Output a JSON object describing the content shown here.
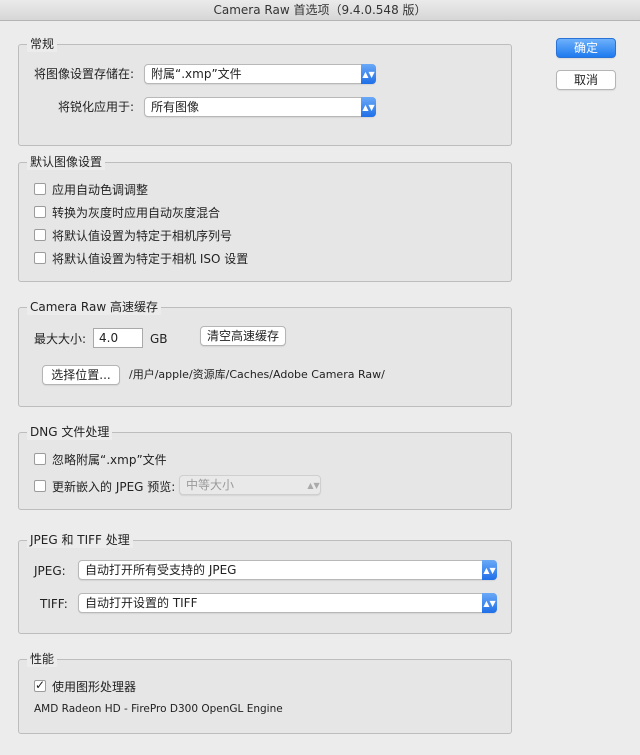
{
  "window": {
    "title": "Camera Raw 首选项（9.4.0.548 版）"
  },
  "buttons": {
    "ok": "确定",
    "cancel": "取消"
  },
  "general": {
    "legend": "常规",
    "save_settings_label": "将图像设置存储在:",
    "save_settings_value": "附属“.xmp”文件",
    "sharpen_label": "将锐化应用于:",
    "sharpen_value": "所有图像"
  },
  "defaults": {
    "legend": "默认图像设置",
    "options": [
      {
        "label": "应用自动色调调整",
        "checked": false
      },
      {
        "label": "转换为灰度时应用自动灰度混合",
        "checked": false
      },
      {
        "label": "将默认值设置为特定于相机序列号",
        "checked": false
      },
      {
        "label": "将默认值设置为特定于相机 ISO 设置",
        "checked": false
      }
    ]
  },
  "cache": {
    "legend": "Camera Raw 高速缓存",
    "max_size_label": "最大大小:",
    "max_size_value": "4.0",
    "unit": "GB",
    "purge_button": "清空高速缓存",
    "select_location_button": "选择位置...",
    "path": "/用户/apple/资源库/Caches/Adobe Camera Raw/"
  },
  "dng": {
    "legend": "DNG 文件处理",
    "ignore_xmp": {
      "label": "忽略附属“.xmp”文件",
      "checked": false
    },
    "update_jpeg": {
      "label": "更新嵌入的 JPEG 预览:",
      "checked": false
    },
    "preview_size": "中等大小"
  },
  "jpeg_tiff": {
    "legend": "JPEG 和 TIFF 处理",
    "jpeg_label": "JPEG:",
    "jpeg_value": "自动打开所有受支持的 JPEG",
    "tiff_label": "TIFF:",
    "tiff_value": "自动打开设置的 TIFF"
  },
  "performance": {
    "legend": "性能",
    "gpu": {
      "label": "使用图形处理器",
      "checked": true
    },
    "gpu_name": "AMD Radeon HD - FirePro D300 OpenGL Engine"
  },
  "colors": {
    "accent": "#1f7aef",
    "background": "#ececec"
  },
  "icons": {
    "select_arrow": "up-down-chevron-icon",
    "check": "checkmark-icon"
  }
}
